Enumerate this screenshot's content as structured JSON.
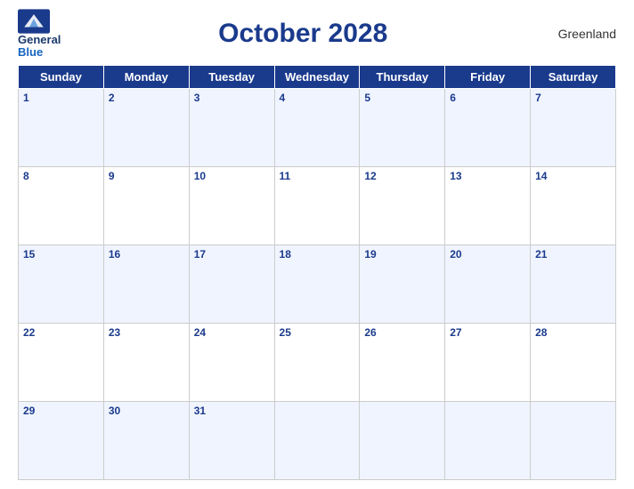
{
  "header": {
    "logo_line1": "General",
    "logo_line2": "Blue",
    "month_year": "October 2028",
    "region": "Greenland"
  },
  "days_of_week": [
    "Sunday",
    "Monday",
    "Tuesday",
    "Wednesday",
    "Thursday",
    "Friday",
    "Saturday"
  ],
  "weeks": [
    [
      {
        "date": "1",
        "empty": false
      },
      {
        "date": "2",
        "empty": false
      },
      {
        "date": "3",
        "empty": false
      },
      {
        "date": "4",
        "empty": false
      },
      {
        "date": "5",
        "empty": false
      },
      {
        "date": "6",
        "empty": false
      },
      {
        "date": "7",
        "empty": false
      }
    ],
    [
      {
        "date": "8",
        "empty": false
      },
      {
        "date": "9",
        "empty": false
      },
      {
        "date": "10",
        "empty": false
      },
      {
        "date": "11",
        "empty": false
      },
      {
        "date": "12",
        "empty": false
      },
      {
        "date": "13",
        "empty": false
      },
      {
        "date": "14",
        "empty": false
      }
    ],
    [
      {
        "date": "15",
        "empty": false
      },
      {
        "date": "16",
        "empty": false
      },
      {
        "date": "17",
        "empty": false
      },
      {
        "date": "18",
        "empty": false
      },
      {
        "date": "19",
        "empty": false
      },
      {
        "date": "20",
        "empty": false
      },
      {
        "date": "21",
        "empty": false
      }
    ],
    [
      {
        "date": "22",
        "empty": false
      },
      {
        "date": "23",
        "empty": false
      },
      {
        "date": "24",
        "empty": false
      },
      {
        "date": "25",
        "empty": false
      },
      {
        "date": "26",
        "empty": false
      },
      {
        "date": "27",
        "empty": false
      },
      {
        "date": "28",
        "empty": false
      }
    ],
    [
      {
        "date": "29",
        "empty": false
      },
      {
        "date": "30",
        "empty": false
      },
      {
        "date": "31",
        "empty": false
      },
      {
        "date": "",
        "empty": true
      },
      {
        "date": "",
        "empty": true
      },
      {
        "date": "",
        "empty": true
      },
      {
        "date": "",
        "empty": true
      }
    ]
  ],
  "colors": {
    "header_bg": "#1a3a8c",
    "accent": "#1565c0",
    "text_dark": "#1a3a8c"
  }
}
